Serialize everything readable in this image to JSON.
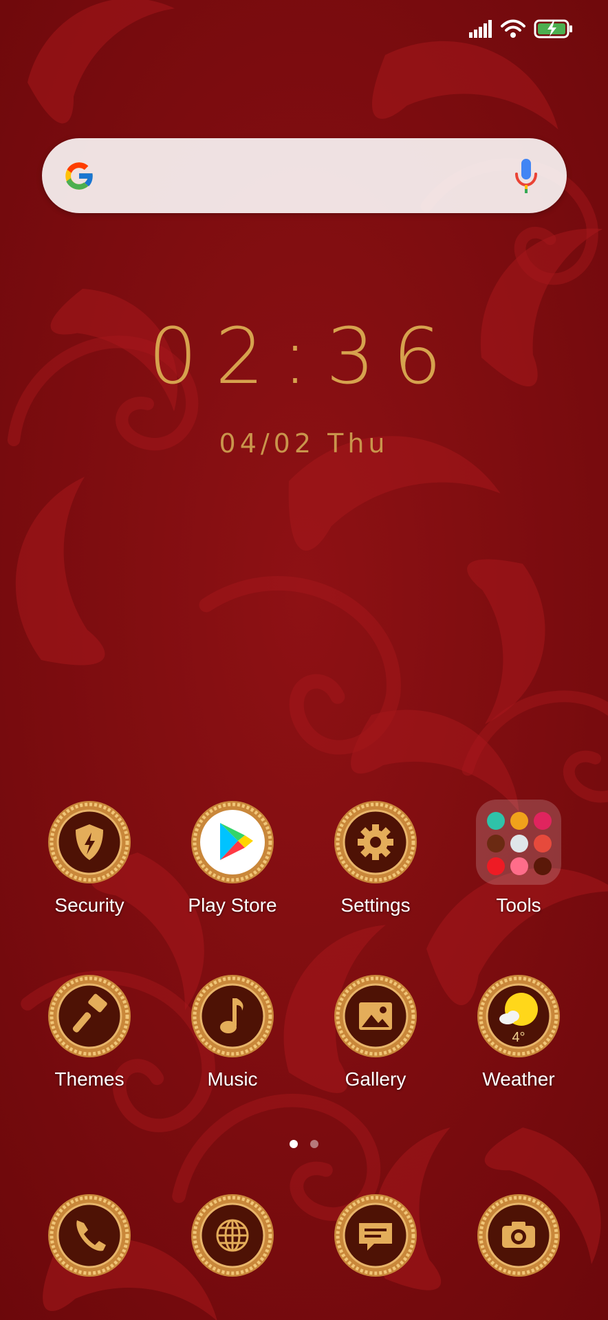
{
  "status_bar": {
    "icons": [
      "signal-icon",
      "wifi-icon",
      "battery-charging-icon"
    ]
  },
  "search": {
    "provider_icon": "google-g-icon",
    "voice_icon": "microphone-icon"
  },
  "clock_widget": {
    "time": "02:36",
    "date": "04/02 Thu"
  },
  "apps_row1": [
    {
      "label": "Security",
      "icon": "shield-bolt-icon"
    },
    {
      "label": "Play Store",
      "icon": "play-store-icon"
    },
    {
      "label": "Settings",
      "icon": "gear-icon"
    },
    {
      "label": "Tools",
      "icon": "folder-icon"
    }
  ],
  "apps_row2": [
    {
      "label": "Themes",
      "icon": "paintbrush-icon"
    },
    {
      "label": "Music",
      "icon": "music-note-icon"
    },
    {
      "label": "Gallery",
      "icon": "image-icon"
    },
    {
      "label": "Weather",
      "icon": "weather-sun-icon",
      "temperature": "4°"
    }
  ],
  "page_indicator": {
    "pages": 2,
    "current": 1
  },
  "dock": [
    {
      "icon": "phone-icon"
    },
    {
      "icon": "globe-icon"
    },
    {
      "icon": "message-icon"
    },
    {
      "icon": "camera-icon"
    }
  ],
  "colors": {
    "wallpaper_base": "#7d0b0e",
    "gold": "#d6a24e",
    "icon_inner": "#5a1808"
  }
}
